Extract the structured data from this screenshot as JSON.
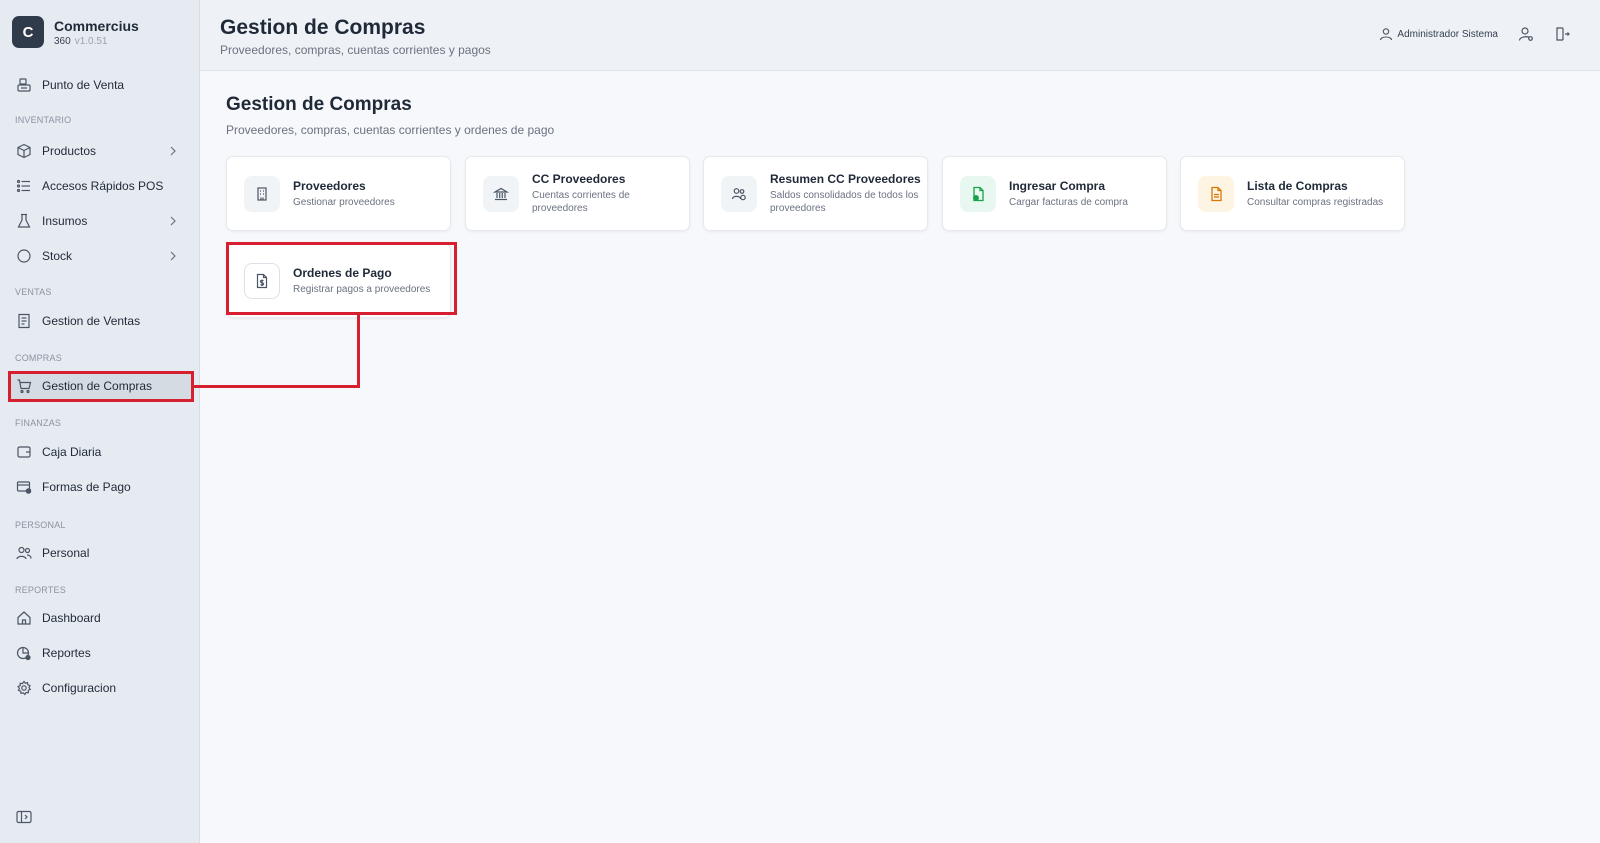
{
  "brand": {
    "logo_letter": "C",
    "name": "Commercius",
    "edition": "360",
    "version": "v1.0.51"
  },
  "sidebar": {
    "top_item": {
      "label": "Punto de Venta",
      "icon": "pos-register-icon"
    },
    "sections": [
      {
        "label": "INVENTARIO",
        "items": [
          {
            "label": "Productos",
            "icon": "box-icon",
            "has_chevron": true
          },
          {
            "label": "Accesos Rápidos POS",
            "icon": "list-icon",
            "has_chevron": false
          },
          {
            "label": "Insumos",
            "icon": "flask-icon",
            "has_chevron": true
          },
          {
            "label": "Stock",
            "icon": "circle-icon",
            "has_chevron": true
          }
        ]
      },
      {
        "label": "VENTAS",
        "items": [
          {
            "label": "Gestion de Ventas",
            "icon": "receipt-icon",
            "has_chevron": false
          }
        ]
      },
      {
        "label": "COMPRAS",
        "items": [
          {
            "label": "Gestion de Compras",
            "icon": "cart-icon",
            "has_chevron": false,
            "active": true
          }
        ]
      },
      {
        "label": "FINANZAS",
        "items": [
          {
            "label": "Caja Diaria",
            "icon": "wallet-icon",
            "has_chevron": false
          },
          {
            "label": "Formas de Pago",
            "icon": "card-payment-icon",
            "has_chevron": false
          }
        ]
      },
      {
        "label": "PERSONAL",
        "items": [
          {
            "label": "Personal",
            "icon": "users-icon",
            "has_chevron": false
          }
        ]
      },
      {
        "label": "REPORTES",
        "items": [
          {
            "label": "Dashboard",
            "icon": "home-icon",
            "has_chevron": false
          },
          {
            "label": "Reportes",
            "icon": "report-icon",
            "has_chevron": false
          },
          {
            "label": "Configuracion",
            "icon": "gear-icon",
            "has_chevron": false
          }
        ]
      }
    ]
  },
  "header": {
    "title": "Gestion de Compras",
    "subtitle": "Proveedores, compras, cuentas corrientes y pagos",
    "user_name": "Administrador Sistema"
  },
  "main": {
    "title": "Gestion de Compras",
    "subtitle": "Proveedores, compras, cuentas corrientes y ordenes de pago",
    "cards": [
      {
        "title": "Proveedores",
        "desc": "Gestionar proveedores",
        "icon": "building-icon"
      },
      {
        "title": "CC Proveedores",
        "desc": "Cuentas corrientes de proveedores",
        "icon": "bank-icon"
      },
      {
        "title": "Resumen CC Proveedores",
        "desc": "Saldos consolidados de todos los proveedores",
        "icon": "users-summary-icon"
      },
      {
        "title": "Ingresar Compra",
        "desc": "Cargar facturas de compra",
        "icon": "file-add-icon"
      },
      {
        "title": "Lista de Compras",
        "desc": "Consultar compras registradas",
        "icon": "file-list-icon"
      },
      {
        "title": "Ordenes de Pago",
        "desc": "Registrar pagos a proveedores",
        "icon": "payment-order-icon"
      }
    ]
  },
  "colors": {
    "highlight": "#d6202f",
    "sidebar_bg": "#e6ebf1",
    "brand_logo": "#2f3b4b"
  }
}
